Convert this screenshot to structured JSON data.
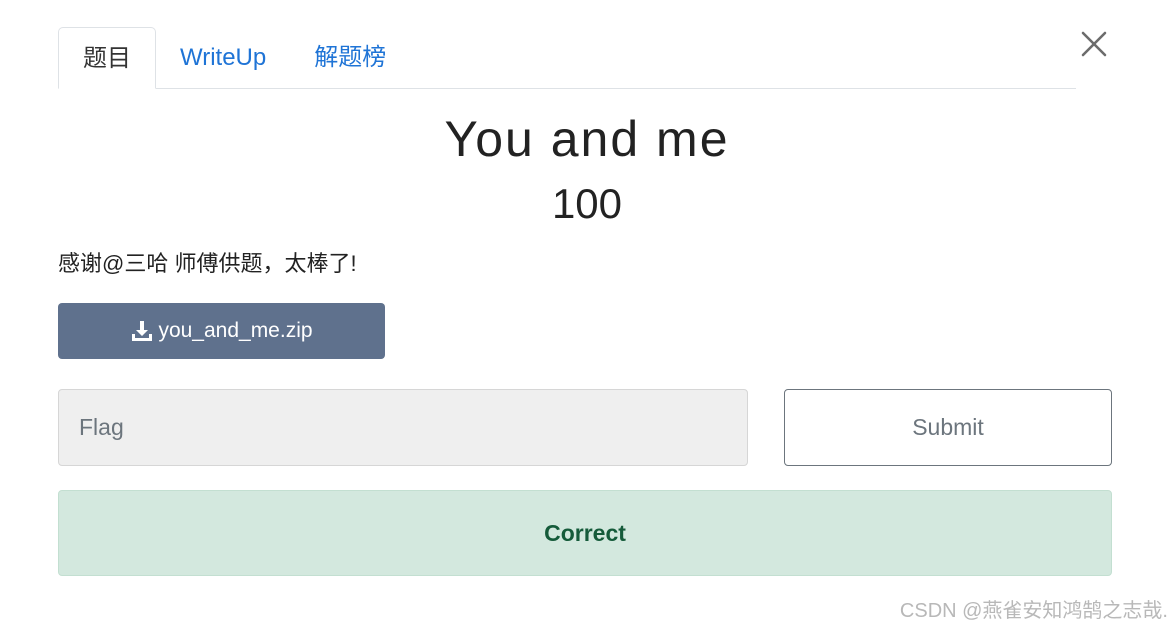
{
  "tabs": [
    {
      "label": "题目",
      "active": true
    },
    {
      "label": "WriteUp",
      "active": false
    },
    {
      "label": "解题榜",
      "active": false
    }
  ],
  "challenge": {
    "title": "You and me",
    "points": "100",
    "description": "感谢@三哈 师傅供题，太棒了!"
  },
  "download": {
    "filename": "you_and_me.zip",
    "icon": "download-icon"
  },
  "flag_input": {
    "value": "",
    "placeholder": "Flag"
  },
  "submit_label": "Submit",
  "result_message": "Correct",
  "watermark": "CSDN @燕雀安知鸿鹄之志哉.",
  "colors": {
    "tab_link": "#1f74d6",
    "download_bg": "#5f718d",
    "success_bg": "#d3e8de",
    "success_text": "#155b3a"
  }
}
